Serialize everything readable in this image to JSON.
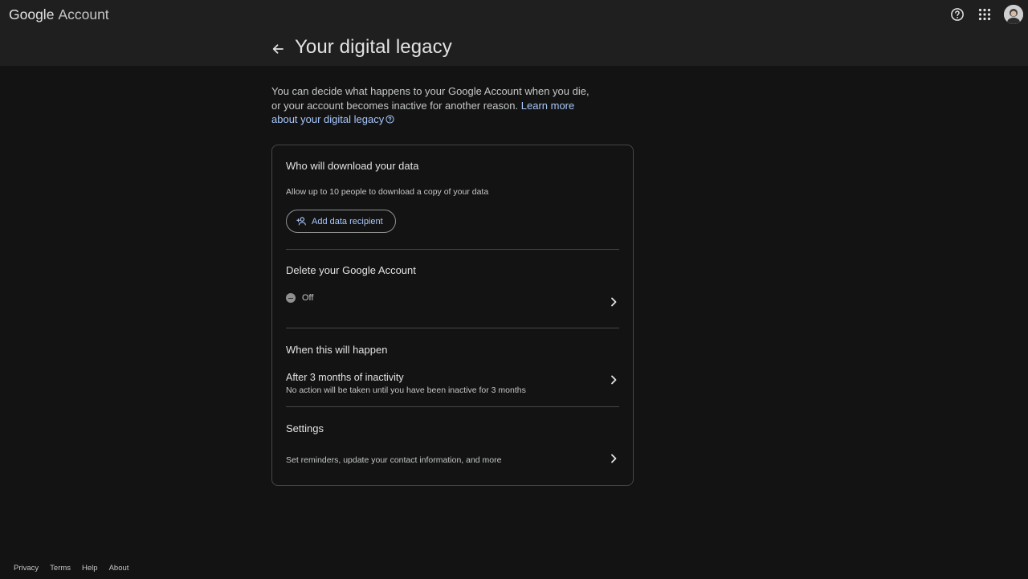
{
  "header": {
    "logo_google": "Google",
    "logo_account": "Account",
    "help_icon": "help-icon",
    "apps_icon": "apps-grid-icon",
    "avatar_icon": "avatar"
  },
  "page": {
    "title": "Your digital legacy",
    "intro_text": "You can decide what happens to your Google Account when you die, or your account becomes inactive for another reason.",
    "intro_link": "Learn more about your digital legacy"
  },
  "card": {
    "download": {
      "title": "Who will download your data",
      "subtitle": "Allow up to 10 people to download a copy of your data",
      "button_label": "Add data recipient"
    },
    "delete": {
      "title": "Delete your Google Account",
      "status": "Off"
    },
    "when": {
      "title": "When this will happen",
      "value": "After 3 months of inactivity",
      "detail": "No action will be taken until you have been inactive for 3 months"
    },
    "settings": {
      "title": "Settings",
      "detail": "Set reminders, update your contact information, and more"
    }
  },
  "footer": {
    "links": [
      "Privacy",
      "Terms",
      "Help",
      "About"
    ]
  },
  "colors": {
    "background": "#131314",
    "surface": "#1f1f1f",
    "link": "#a8c7fa",
    "border": "#444746"
  }
}
